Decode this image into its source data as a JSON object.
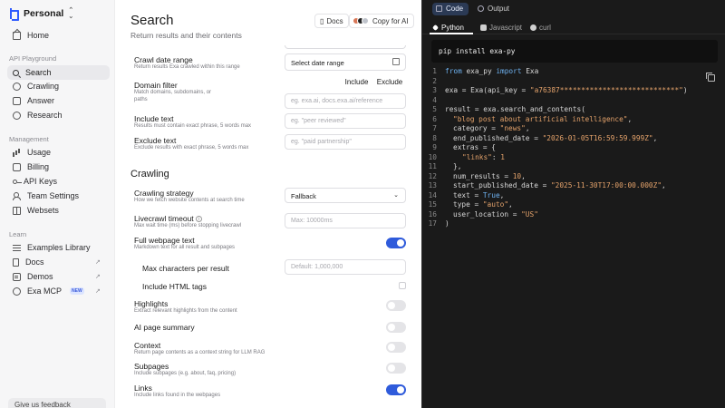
{
  "sidebar": {
    "workspace": "Personal",
    "home": "Home",
    "api_playground_label": "API Playground",
    "playground_items": [
      "Search",
      "Crawling",
      "Answer",
      "Research"
    ],
    "management_label": "Management",
    "management_items": [
      "Usage",
      "Billing",
      "API Keys",
      "Team Settings",
      "Websets"
    ],
    "learn_label": "Learn",
    "learn_items": [
      "Examples Library",
      "Docs",
      "Demos",
      "Exa MCP"
    ],
    "new_badge": "NEW",
    "feedback": "Give us feedback"
  },
  "main": {
    "title": "Search",
    "subtitle": "Return results and their contents",
    "docs_label": "Docs",
    "copy_ai_label": "Copy for AI",
    "crawl_date": {
      "label": "Crawl date range",
      "help": "Return results Exa crawled within this range",
      "placeholder": "Select date range"
    },
    "domain_filter": {
      "label": "Domain filter",
      "help": "Match domains, subdomains, or paths",
      "include": "Include",
      "exclude": "Exclude",
      "placeholder": "eg. exa.ai, docs.exa.ai/reference"
    },
    "include_text": {
      "label": "Include text",
      "help": "Results must contain exact phrase, 5 words max",
      "placeholder": "eg. \"peer reviewed\""
    },
    "exclude_text": {
      "label": "Exclude text",
      "help": "Exclude results with exact phrase, 5 words max",
      "placeholder": "eg. \"paid partnership\""
    },
    "crawling_title": "Crawling",
    "crawling_strategy": {
      "label": "Crawling strategy",
      "help": "How we fetch website contents at search time",
      "value": "Fallback"
    },
    "livecrawl_timeout": {
      "label": "Livecrawl timeout",
      "help": "Max wait time (ms) before stopping livecrawl",
      "placeholder": "Max: 10000ms"
    },
    "full_webpage": {
      "label": "Full webpage text",
      "help": "Markdown text for all result and subpages",
      "on": true
    },
    "max_chars": {
      "label": "Max characters per result",
      "placeholder": "Default: 1,000,000"
    },
    "include_html": {
      "label": "Include HTML tags",
      "checked": false
    },
    "highlights": {
      "label": "Highlights",
      "help": "Extract relevant highlights from the content",
      "on": false
    },
    "ai_summary": {
      "label": "AI page summary",
      "on": false
    },
    "context": {
      "label": "Context",
      "help": "Return page contents as a context string for LLM RAG",
      "on": false
    },
    "subpages": {
      "label": "Subpages",
      "help": "Include subpages (e.g. about, faq, pricing)",
      "on": false
    },
    "links": {
      "label": "Links",
      "help": "Include links found in the webpages",
      "on": true
    }
  },
  "code_panel": {
    "tabs": [
      "Code",
      "Output"
    ],
    "languages": [
      "Python",
      "Javascript",
      "curl"
    ],
    "install_cmd": "pip install exa-py",
    "line_numbers": [
      "1",
      "2",
      "3",
      "4",
      "5",
      "6",
      "7",
      "8",
      "9",
      "10",
      "11",
      "12",
      "13",
      "14",
      "15",
      "16",
      "17"
    ],
    "code": {
      "l1_kw1": "from",
      "l1_mod": " exa_py ",
      "l1_kw2": "import",
      "l1_name": " Exa",
      "l3_a": "exa = Exa(api_key = ",
      "l3_s": "\"a76387****************************\"",
      "l3_b": ")",
      "l5": "result = exa.search_and_contents(",
      "l6_s": "\"blog post about artificial intelligence\"",
      "l6_b": ",",
      "l7_a": "category = ",
      "l7_s": "\"news\"",
      "l7_b": ",",
      "l8_a": "end_published_date = ",
      "l8_s": "\"2026-01-05T16:59:59.999Z\"",
      "l8_b": ",",
      "l9": "extras = {",
      "l10_s": "\"links\"",
      "l10_a": ": ",
      "l10_n": "1",
      "l11": "},",
      "l12_a": "num_results = ",
      "l12_n": "10",
      "l12_b": ",",
      "l13_a": "start_published_date = ",
      "l13_s": "\"2025-11-30T17:00:00.000Z\"",
      "l13_b": ",",
      "l14_a": "text = ",
      "l14_k": "True",
      "l14_b": ",",
      "l15_a": "type = ",
      "l15_s": "\"auto\"",
      "l15_b": ",",
      "l16_a": "user_location = ",
      "l16_s": "\"US\"",
      "l17": ")"
    }
  },
  "colors": {
    "accent": "#2f5bdb",
    "code_bg": "#1a1a1a",
    "string": "#e5a36b",
    "keyword": "#6fb3f2"
  }
}
